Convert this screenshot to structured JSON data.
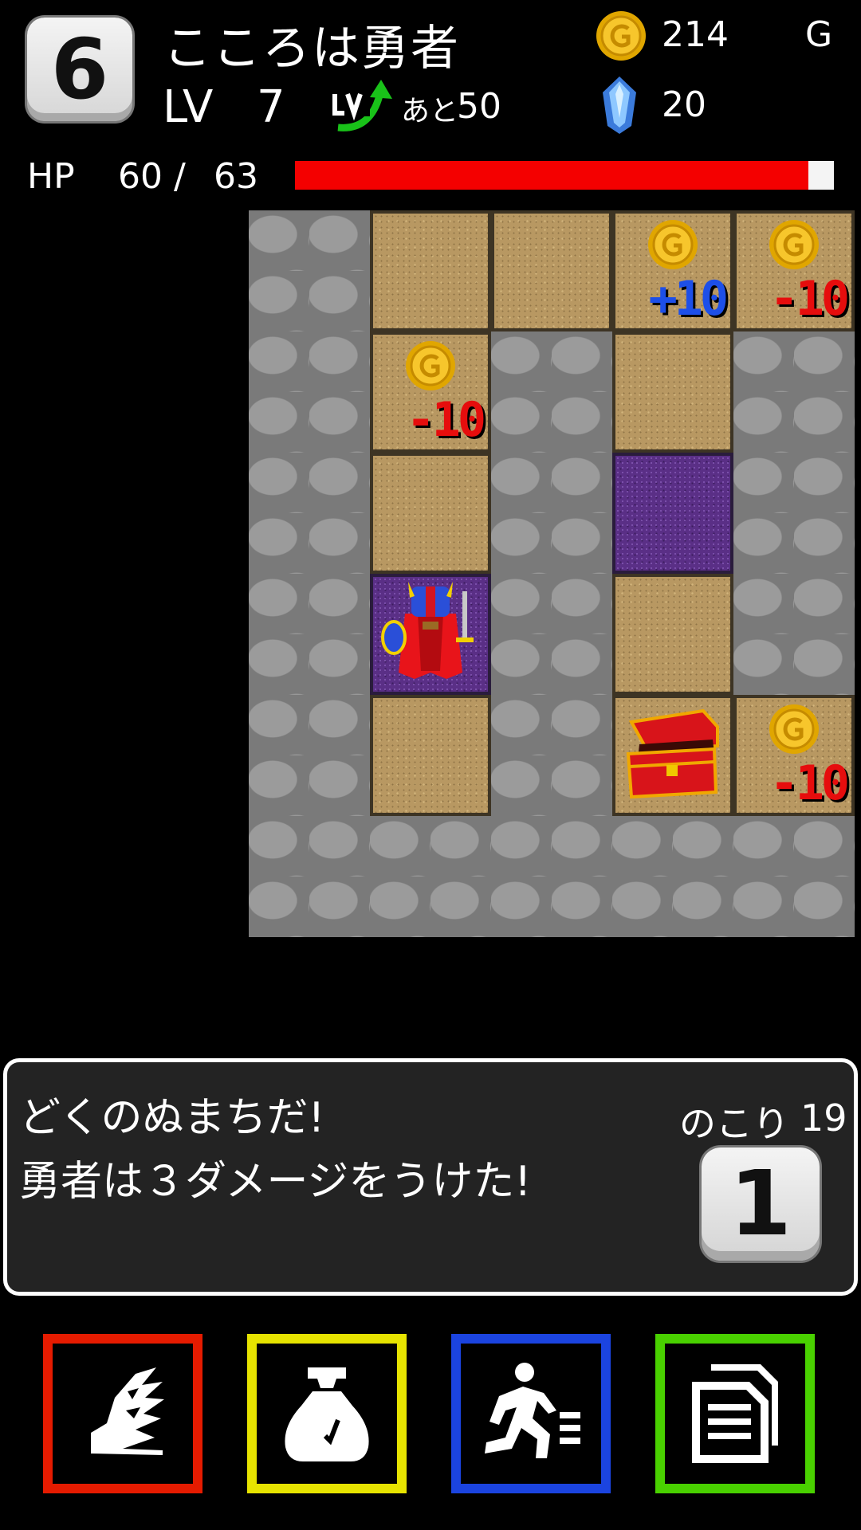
{
  "header": {
    "floor_number": "6",
    "hero_name": "こころは勇者",
    "level_label": "LV",
    "level_value": "7",
    "exp_prefix": "あと",
    "exp_to_next": "50",
    "gold_value": "214",
    "gold_unit": "G",
    "gems_value": "20"
  },
  "hp": {
    "label": "HP",
    "current": "60",
    "separator": "/",
    "max": "63",
    "fill_fraction": 0.952
  },
  "map": {
    "columns": 5,
    "rows": 6,
    "tiles": [
      [
        "stone",
        "sand",
        "sand",
        "sand",
        "sand"
      ],
      [
        "stone",
        "sand",
        "stone",
        "sand",
        "stone"
      ],
      [
        "stone",
        "sand",
        "stone",
        "swamp",
        "stone"
      ],
      [
        "stone",
        "swamp",
        "stone",
        "sand",
        "stone"
      ],
      [
        "stone",
        "sand",
        "stone",
        "sand",
        "sand"
      ],
      [
        "stone",
        "stone",
        "stone",
        "stone",
        "stone"
      ]
    ],
    "coins": [
      {
        "row": 0,
        "col": 3,
        "delta": "+10",
        "color": "#1d4fe8"
      },
      {
        "row": 0,
        "col": 4,
        "delta": "-10",
        "color": "#e60d0d"
      },
      {
        "row": 1,
        "col": 1,
        "delta": "-10",
        "color": "#e60d0d"
      },
      {
        "row": 4,
        "col": 4,
        "delta": "-10",
        "color": "#e60d0d"
      }
    ],
    "hero": {
      "row": 3,
      "col": 1
    },
    "chest": {
      "row": 4,
      "col": 3
    }
  },
  "message": {
    "line1": "どくのぬまちだ!",
    "line2": "勇者は３ダメージをうけた!",
    "remaining_label": "のこり",
    "remaining_value": "19",
    "die_value": "1"
  },
  "commands": [
    {
      "name": "magic-button",
      "icon": "wing-icon",
      "color": "#e51b00"
    },
    {
      "name": "bag-button",
      "icon": "bag-icon",
      "color": "#e6e300"
    },
    {
      "name": "escape-button",
      "icon": "running-man-icon",
      "color": "#1b44e0"
    },
    {
      "name": "status-button",
      "icon": "document-icon",
      "color": "#49d100"
    }
  ]
}
